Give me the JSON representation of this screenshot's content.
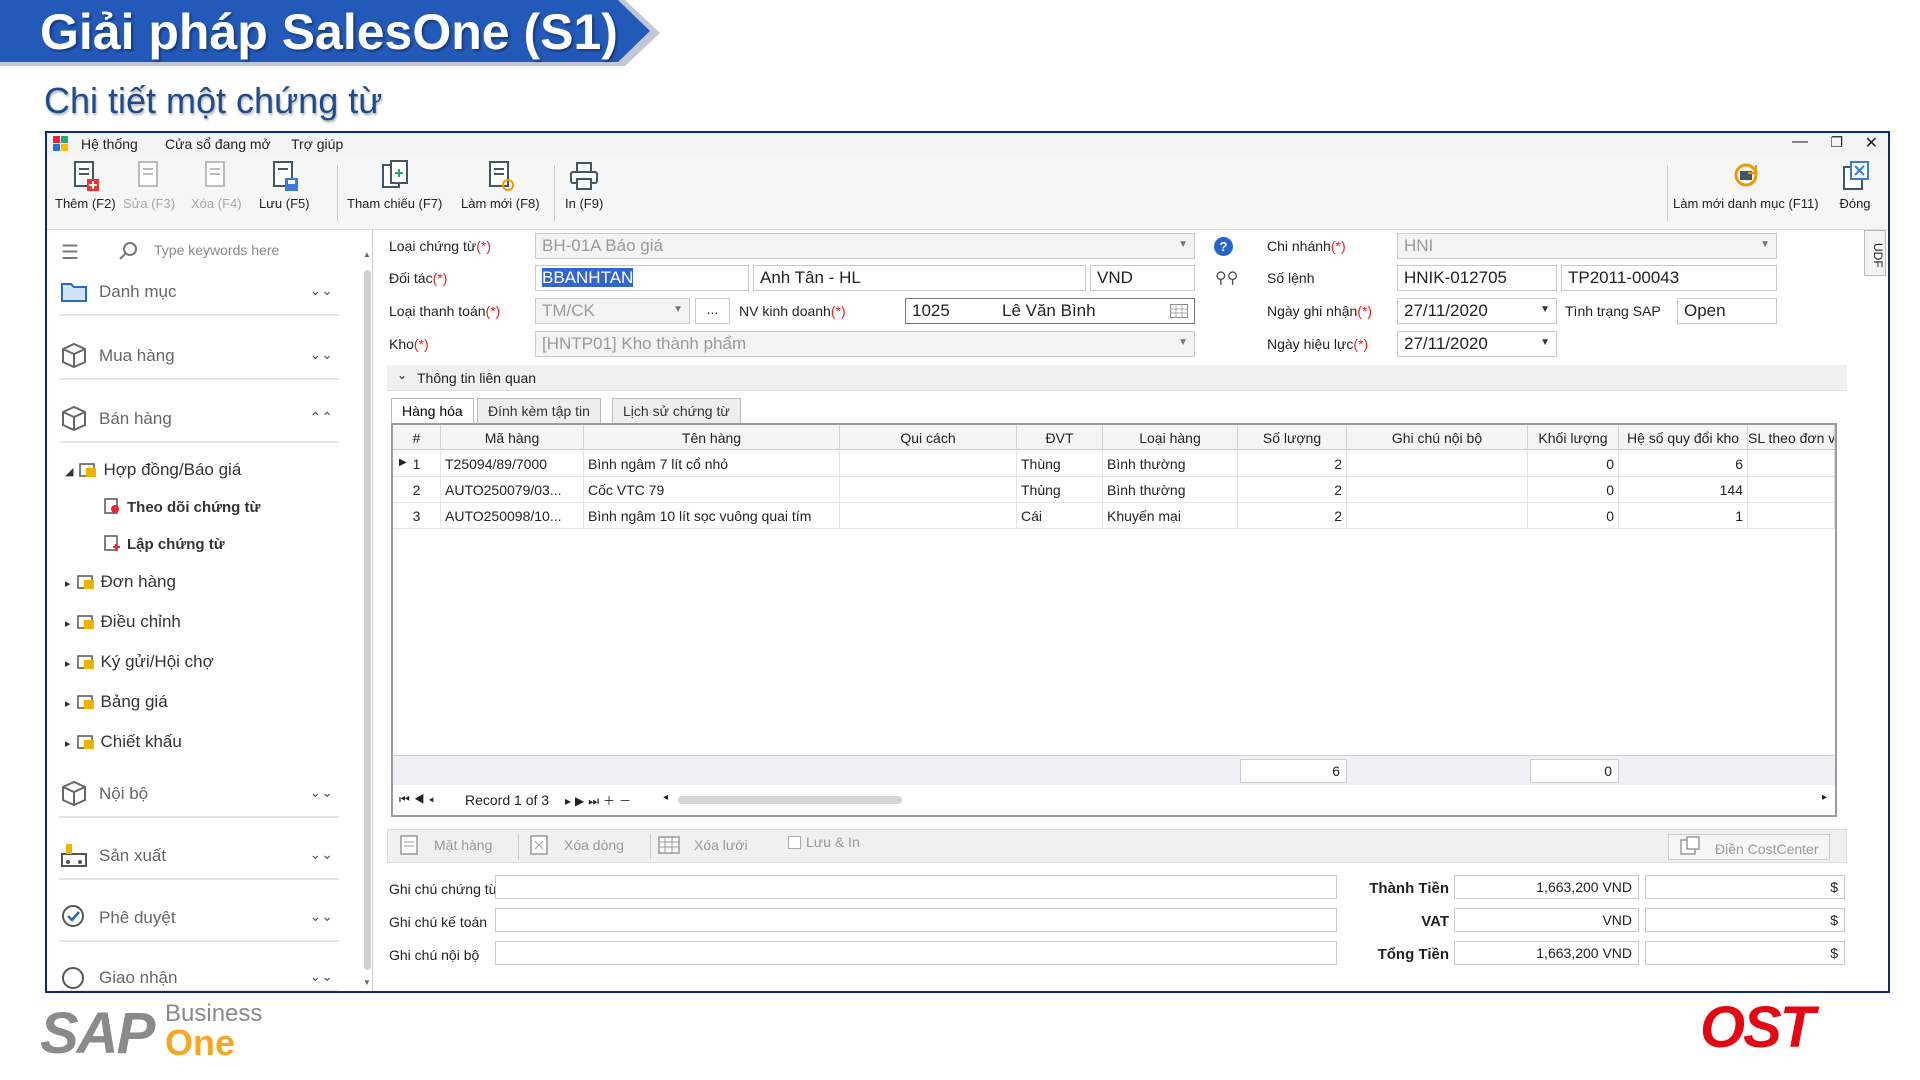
{
  "slide": {
    "title": "Giải pháp SalesOne (S1)",
    "subtitle": "Chi tiết một chứng từ"
  },
  "colors": {
    "banner": "#2359b8",
    "subtitle": "#1e4c8a",
    "sap_grey": "#8a8a8a",
    "sap_orange": "#f5a623",
    "ost_red": "#e30613"
  },
  "logos": {
    "sap_main": "SAP",
    "sap_business": "Business",
    "sap_one": "One",
    "ost": "OST"
  },
  "menu": [
    "Hệ thống",
    "Cửa sổ đang mở",
    "Trợ giúp"
  ],
  "toolbar": {
    "add": "Thêm (F2)",
    "edit": "Sửa (F3)",
    "delete": "Xóa (F4)",
    "save": "Lưu (F5)",
    "reference": "Tham chiếu (F7)",
    "refresh": "Làm mới (F8)",
    "print": "In (F9)",
    "refresh_catalog": "Làm mới danh mục (F11)",
    "close": "Đóng"
  },
  "sidebar": {
    "search_placeholder": "Type keywords here",
    "groups": [
      "Danh mục",
      "Mua hàng",
      "Bán hàng",
      "Nội bộ",
      "Sản xuất",
      "Phê duyệt",
      "Giao nhận"
    ],
    "tree": {
      "contract": "Hợp đồng/Báo giá",
      "track": "Theo dõi chứng từ",
      "create": "Lập chứng từ",
      "order": "Đơn hàng",
      "adjust": "Điều chỉnh",
      "consign": "Ký gửi/Hội chợ",
      "pricelist": "Bảng giá",
      "discount": "Chiết khấu"
    }
  },
  "form": {
    "doc_type_label": "Loại chứng từ",
    "doc_type": "BH-01A Báo giá",
    "partner_label": "Đối tác",
    "partner_code": "BBANHTAN",
    "partner_name": "Anh Tân - HL",
    "currency": "VND",
    "pay_type_label": "Loại thanh toán",
    "pay_type": "TM/CK",
    "ellipsis": "...",
    "sales_label": "NV kinh doanh",
    "sales_code": "1025",
    "sales_name": "Lê Văn Bình",
    "warehouse_label": "Kho",
    "warehouse": "[HNTP01] Kho thành phẩm",
    "branch_label": "Chi nhánh",
    "branch": "HNI",
    "order_no_label": "Số lệnh",
    "order_no": "HNIK-012705",
    "order_no2": "TP2011-00043",
    "record_date_label": "Ngày ghi nhận",
    "record_date": "27/11/2020",
    "sap_status_label": "Tình trạng SAP",
    "sap_status": "Open",
    "effective_date_label": "Ngày hiệu lực",
    "effective_date": "27/11/2020",
    "req": "(*)",
    "help": "?",
    "udf": "UDF"
  },
  "section": "Thông tin liên quan",
  "tabs": [
    "Hàng hóa",
    "Đính kèm tập tin",
    "Lịch sử chứng từ"
  ],
  "grid": {
    "headers": [
      "#",
      "Mã hàng",
      "Tên hàng",
      "Qui cách",
      "ĐVT",
      "Loại hàng",
      "Số lượng",
      "Ghi chú nội bộ",
      "Khối lượng",
      "Hệ số quy đổi kho",
      "SL theo đơn vị"
    ],
    "rows": [
      {
        "no": "1",
        "code": "T25094/89/7000",
        "name": "Bình ngâm 7 lít cổ nhỏ",
        "spec": "",
        "unit": "Thùng",
        "type": "Bình thường",
        "qty": "2",
        "note": "",
        "weight": "0",
        "factor": "6"
      },
      {
        "no": "2",
        "code": "AUTO250079/03...",
        "name": "Cốc VTC 79",
        "spec": "",
        "unit": "Thùng",
        "type": "Bình thường",
        "qty": "2",
        "note": "",
        "weight": "0",
        "factor": "144"
      },
      {
        "no": "3",
        "code": "AUTO250098/10...",
        "name": "Bình ngâm 10 lít sọc vuông quai tím",
        "spec": "",
        "unit": "Cái",
        "type": "Khuyến mại",
        "qty": "2",
        "note": "",
        "weight": "0",
        "factor": "1"
      }
    ],
    "sum_qty": "6",
    "sum_weight": "0",
    "record": "Record 1 of 3"
  },
  "buttons": {
    "item": "Mặt hàng",
    "delete_row": "Xóa dòng",
    "delete_grid": "Xóa lưới",
    "save_print": "Lưu & In",
    "cost_center": "Điền CostCenter"
  },
  "notes": {
    "doc_note": "Ghi chú chứng từ",
    "acct_note": "Ghi chú kế toán",
    "internal_note": "Ghi chú nội bộ"
  },
  "totals": {
    "subtotal_label": "Thành Tiền",
    "subtotal": "1,663,200 VND",
    "vat_label": "VAT",
    "vat": "VND",
    "total_label": "Tổng Tiền",
    "total": "1,663,200 VND",
    "usd": "$"
  }
}
